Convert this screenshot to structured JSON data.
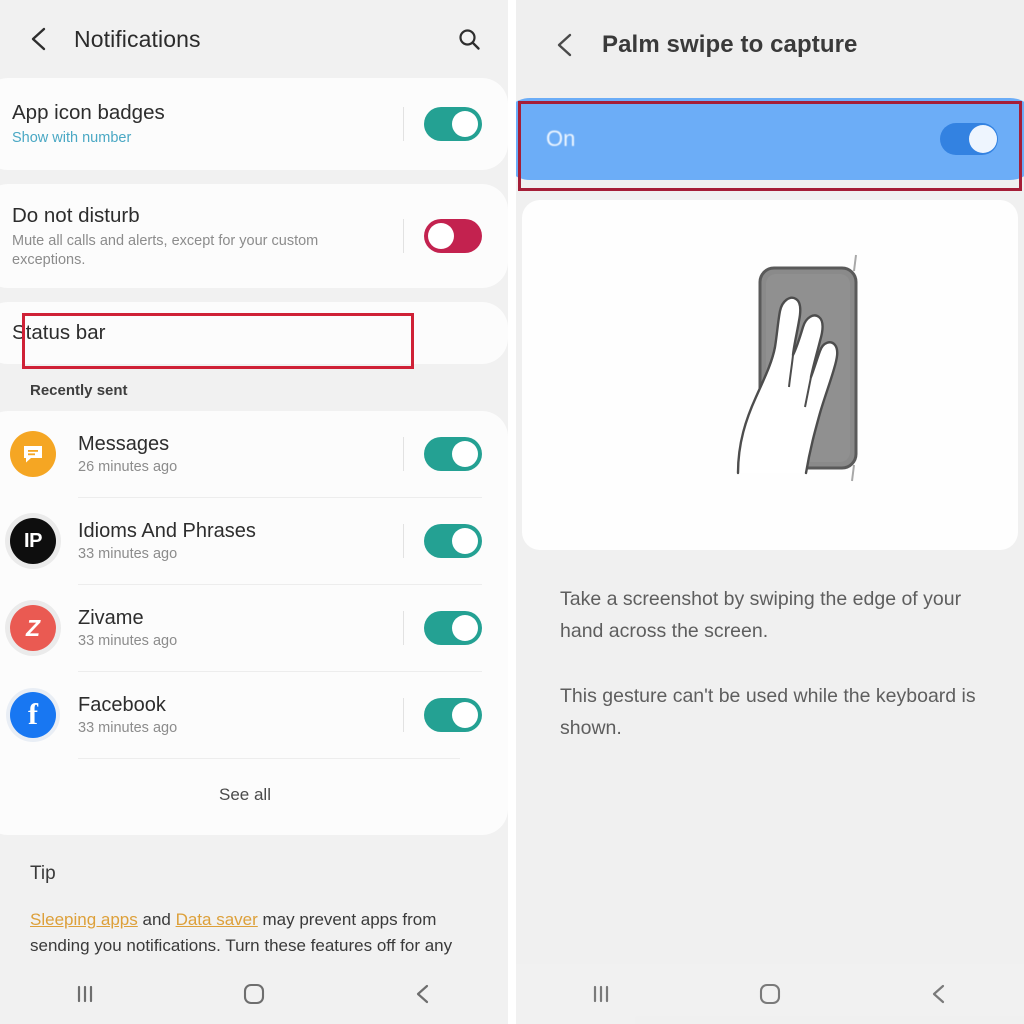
{
  "left_panel": {
    "header": {
      "back_icon": "chevron-left-icon",
      "title": "Notifications",
      "search_icon": "search-icon"
    },
    "app_icon_badges": {
      "title": "App icon badges",
      "subtitle": "Show with number",
      "toggle_state": "on"
    },
    "do_not_disturb": {
      "title": "Do not disturb",
      "subtitle": "Mute all calls and alerts, except for your custom exceptions.",
      "toggle_state": "off"
    },
    "status_bar": {
      "title": "Status bar",
      "highlighted": true
    },
    "section_label": "Recently sent",
    "apps": [
      {
        "name": "Messages",
        "time": "26 minutes ago",
        "icon": "messages-icon",
        "icon_text": "",
        "toggle_state": "on"
      },
      {
        "name": "Idioms And Phrases",
        "time": "33 minutes ago",
        "icon": "idioms-icon",
        "icon_text": "IP",
        "toggle_state": "on"
      },
      {
        "name": "Zivame",
        "time": "33 minutes ago",
        "icon": "zivame-icon",
        "icon_text": "Z",
        "toggle_state": "on"
      },
      {
        "name": "Facebook",
        "time": "33 minutes ago",
        "icon": "facebook-icon",
        "icon_text": "f",
        "toggle_state": "on"
      }
    ],
    "see_all": "See all",
    "tip": {
      "heading": "Tip",
      "link1": "Sleeping apps",
      "middle": " and ",
      "link2": "Data saver",
      "rest": " may prevent apps from sending you notifications. Turn these features off for any"
    }
  },
  "right_panel": {
    "header": {
      "back_icon": "chevron-left-icon",
      "title": "Palm swipe to capture"
    },
    "on_row": {
      "label": "On",
      "toggle_state": "on",
      "highlighted": true
    },
    "illustration": "hand-swipe-phone-illustration",
    "description": [
      "Take a screenshot by swiping the edge of your hand across the screen.",
      "This gesture can't be used while the keyboard is shown."
    ]
  },
  "navbar": {
    "recents_icon": "recents-icon",
    "home_icon": "home-icon",
    "back_icon": "back-icon"
  },
  "colors": {
    "toggle_on": "#24a193",
    "toggle_off_crimson": "#c3224f",
    "highlight_blue": "#6cadf7",
    "highlight_border_red": "#cf2136",
    "link_teal": "#4aa8c4",
    "tip_link_amber": "#dda03a"
  }
}
